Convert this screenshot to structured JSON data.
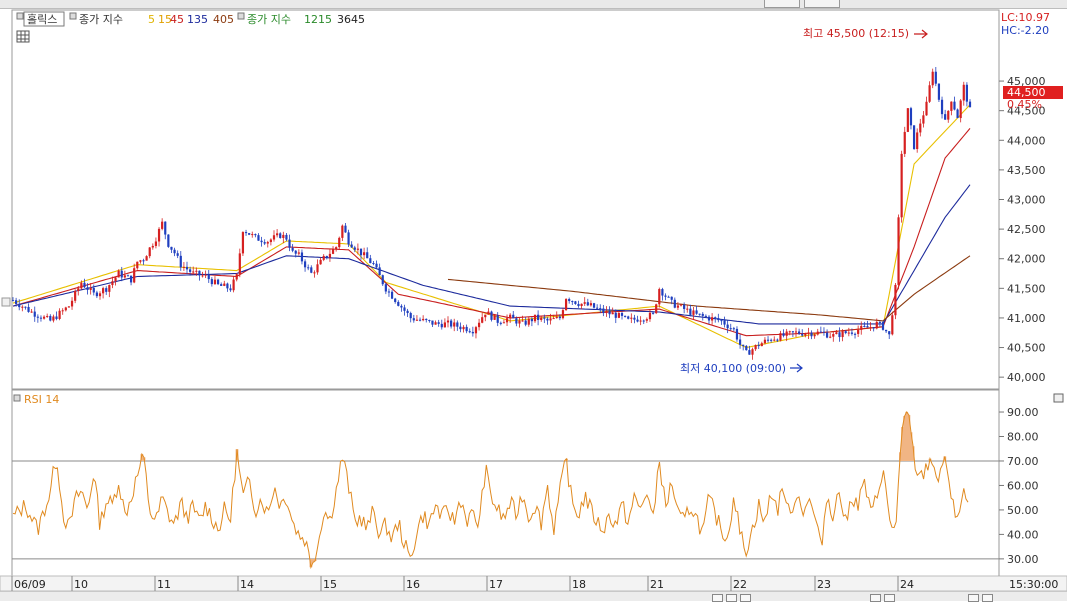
{
  "indicator_bar": {
    "tab_label": "홀릭스",
    "vol_ma_label": "종가 지수",
    "vol_ma_periods": [
      "5",
      "15",
      "45",
      "135",
      "405"
    ],
    "vol_ma_colors": [
      "#e0b400",
      "#e0a000",
      "#c81e1e",
      "#1c2a9c",
      "#8b3a0f"
    ],
    "vol_long_label": "종가 지수",
    "vol_long_periods": [
      "1215",
      "3645"
    ]
  },
  "lc_label": "LC:10.97",
  "hc_label": "HC:-2.20",
  "current_price": "44,500",
  "current_pct": "0.45%",
  "max_label": "최고 45,500 (12:15)",
  "min_label": "최저 40,100 (09:00)",
  "rsi_label": "RSI 14",
  "time_label": "15:30:00",
  "colors": {
    "up": "#d62020",
    "down": "#1f3fbf",
    "ma5": "#e8c000",
    "ma15": "#c81e1e",
    "ma45": "#1c2a9c",
    "ma135": "#8b3a0f",
    "rsi": "#e08a20",
    "grid": "#8a8a8a"
  },
  "chart_data": [
    {
      "type": "candlestick",
      "title": "",
      "y_ticks": [
        "45,000",
        "44,500",
        "44,000",
        "43,500",
        "43,000",
        "42,500",
        "42,000",
        "41,500",
        "41,000",
        "40,500",
        "40,000"
      ],
      "ylim": [
        39800,
        46200
      ],
      "x_date_labels": [
        "06/09",
        "10",
        "11",
        "14",
        "15",
        "16",
        "17",
        "18",
        "21",
        "22",
        "23",
        "24"
      ],
      "grid": false,
      "series": [
        {
          "name": "5",
          "type": "ma"
        },
        {
          "name": "15",
          "type": "ma"
        },
        {
          "name": "45",
          "type": "ma"
        },
        {
          "name": "135",
          "type": "ma"
        }
      ],
      "price_path": [
        [
          0,
          41300
        ],
        [
          3,
          41100
        ],
        [
          6,
          40950
        ],
        [
          9,
          41200
        ],
        [
          11,
          41600
        ],
        [
          13,
          41400
        ],
        [
          15,
          41500
        ],
        [
          17,
          41750
        ],
        [
          19,
          41650
        ],
        [
          20,
          41950
        ],
        [
          21,
          42000
        ],
        [
          23,
          42350
        ],
        [
          24,
          42600
        ],
        [
          25,
          42250
        ],
        [
          26,
          42100
        ],
        [
          27,
          41900
        ],
        [
          29,
          41750
        ],
        [
          31,
          41700
        ],
        [
          33,
          41550
        ],
        [
          35,
          41500
        ],
        [
          36,
          41700
        ],
        [
          37,
          42500
        ],
        [
          39,
          42350
        ],
        [
          41,
          42300
        ],
        [
          43,
          42400
        ],
        [
          44,
          42350
        ],
        [
          45,
          42100
        ],
        [
          46,
          42050
        ],
        [
          48,
          41750
        ],
        [
          50,
          42000
        ],
        [
          52,
          42200
        ],
        [
          53,
          42550
        ],
        [
          54,
          42300
        ],
        [
          56,
          42100
        ],
        [
          58,
          41900
        ],
        [
          60,
          41500
        ],
        [
          62,
          41250
        ],
        [
          64,
          41000
        ],
        [
          66,
          40950
        ],
        [
          68,
          40900
        ],
        [
          70,
          40900
        ],
        [
          72,
          40850
        ],
        [
          74,
          40800
        ],
        [
          76,
          41100
        ],
        [
          78,
          40950
        ],
        [
          80,
          41000
        ],
        [
          82,
          40900
        ],
        [
          84,
          41000
        ],
        [
          86,
          40950
        ],
        [
          88,
          41000
        ],
        [
          89,
          41350
        ],
        [
          91,
          41250
        ],
        [
          93,
          41200
        ],
        [
          95,
          41100
        ],
        [
          97,
          41050
        ],
        [
          99,
          40950
        ],
        [
          101,
          41000
        ],
        [
          103,
          41050
        ],
        [
          104,
          41500
        ],
        [
          106,
          41250
        ],
        [
          108,
          41150
        ],
        [
          110,
          41050
        ],
        [
          112,
          41000
        ],
        [
          114,
          40950
        ],
        [
          116,
          40800
        ],
        [
          117,
          40550
        ],
        [
          118,
          40400
        ],
        [
          120,
          40550
        ],
        [
          122,
          40650
        ],
        [
          124,
          40700
        ],
        [
          126,
          40750
        ],
        [
          128,
          40750
        ],
        [
          130,
          40750
        ],
        [
          132,
          40700
        ],
        [
          134,
          40750
        ],
        [
          136,
          40800
        ],
        [
          138,
          40850
        ],
        [
          139,
          40900
        ],
        [
          140,
          40850
        ],
        [
          141,
          40700
        ],
        [
          142,
          41500
        ],
        [
          143,
          43800
        ],
        [
          144,
          44500
        ],
        [
          145,
          43900
        ],
        [
          146,
          44300
        ],
        [
          147,
          44600
        ],
        [
          148,
          45200
        ],
        [
          149,
          44700
        ],
        [
          150,
          44300
        ],
        [
          151,
          44700
        ],
        [
          152,
          44400
        ],
        [
          153,
          44900
        ],
        [
          154,
          44500
        ]
      ],
      "ma_values": {
        "5": [
          [
            0,
            41250
          ],
          [
            20,
            41900
          ],
          [
            36,
            41800
          ],
          [
            44,
            42300
          ],
          [
            54,
            42250
          ],
          [
            60,
            41600
          ],
          [
            80,
            40950
          ],
          [
            104,
            41200
          ],
          [
            118,
            40500
          ],
          [
            130,
            40750
          ],
          [
            140,
            40850
          ],
          [
            145,
            43600
          ],
          [
            154,
            44600
          ]
        ],
        "15": [
          [
            0,
            41200
          ],
          [
            20,
            41800
          ],
          [
            36,
            41700
          ],
          [
            44,
            42200
          ],
          [
            54,
            42150
          ],
          [
            62,
            41400
          ],
          [
            80,
            41000
          ],
          [
            104,
            41150
          ],
          [
            118,
            40700
          ],
          [
            130,
            40750
          ],
          [
            140,
            40850
          ],
          [
            145,
            42200
          ],
          [
            150,
            43700
          ],
          [
            154,
            44200
          ]
        ],
        "45": [
          [
            0,
            41200
          ],
          [
            20,
            41700
          ],
          [
            36,
            41750
          ],
          [
            44,
            42050
          ],
          [
            54,
            42000
          ],
          [
            66,
            41550
          ],
          [
            80,
            41200
          ],
          [
            104,
            41100
          ],
          [
            120,
            40900
          ],
          [
            140,
            40900
          ],
          [
            145,
            41800
          ],
          [
            150,
            42700
          ],
          [
            154,
            43250
          ]
        ],
        "135": [
          [
            70,
            41650
          ],
          [
            90,
            41450
          ],
          [
            110,
            41200
          ],
          [
            130,
            41050
          ],
          [
            140,
            40950
          ],
          [
            145,
            41400
          ],
          [
            154,
            42050
          ]
        ]
      }
    },
    {
      "type": "line",
      "title": "RSI 14",
      "y_ticks": [
        "90.00",
        "80.00",
        "70.00",
        "60.00",
        "50.00",
        "40.00",
        "30.00"
      ],
      "ylim": [
        23,
        99
      ],
      "reference_lines": [
        70,
        30
      ],
      "series": [
        {
          "name": "RSI 14",
          "values": [
            [
              0,
              47
            ],
            [
              2,
              52
            ],
            [
              4,
              42
            ],
            [
              5,
              50
            ],
            [
              6,
              57
            ],
            [
              7,
              73
            ],
            [
              8,
              49
            ],
            [
              9,
              42
            ],
            [
              10,
              54
            ],
            [
              11,
              58
            ],
            [
              12,
              50
            ],
            [
              13,
              66
            ],
            [
              14,
              44
            ],
            [
              15,
              54
            ],
            [
              16,
              52
            ],
            [
              17,
              62
            ],
            [
              18,
              48
            ],
            [
              19,
              55
            ],
            [
              20,
              64
            ],
            [
              21,
              72
            ],
            [
              22,
              50
            ],
            [
              23,
              45
            ],
            [
              24,
              55
            ],
            [
              25,
              48
            ],
            [
              26,
              44
            ],
            [
              27,
              53
            ],
            [
              28,
              47
            ],
            [
              29,
              51
            ],
            [
              30,
              45
            ],
            [
              31,
              52
            ],
            [
              32,
              47
            ],
            [
              33,
              42
            ],
            [
              34,
              50
            ],
            [
              35,
              46
            ],
            [
              36,
              74
            ],
            [
              37,
              55
            ],
            [
              38,
              62
            ],
            [
              39,
              50
            ],
            [
              40,
              55
            ],
            [
              41,
              48
            ],
            [
              42,
              60
            ],
            [
              43,
              52
            ],
            [
              44,
              56
            ],
            [
              45,
              45
            ],
            [
              46,
              40
            ],
            [
              47,
              38
            ],
            [
              48,
              28
            ],
            [
              49,
              35
            ],
            [
              50,
              50
            ],
            [
              51,
              46
            ],
            [
              52,
              58
            ],
            [
              53,
              72
            ],
            [
              54,
              60
            ],
            [
              55,
              45
            ],
            [
              56,
              47
            ],
            [
              57,
              42
            ],
            [
              58,
              50
            ],
            [
              59,
              40
            ],
            [
              60,
              44
            ],
            [
              61,
              38
            ],
            [
              62,
              45
            ],
            [
              63,
              36
            ],
            [
              64,
              29
            ],
            [
              65,
              42
            ],
            [
              66,
              48
            ],
            [
              67,
              44
            ],
            [
              68,
              52
            ],
            [
              69,
              47
            ],
            [
              70,
              50
            ],
            [
              71,
              45
            ],
            [
              72,
              55
            ],
            [
              73,
              46
            ],
            [
              74,
              48
            ],
            [
              75,
              44
            ],
            [
              76,
              67
            ],
            [
              77,
              55
            ],
            [
              78,
              50
            ],
            [
              79,
              46
            ],
            [
              80,
              53
            ],
            [
              81,
              48
            ],
            [
              82,
              57
            ],
            [
              83,
              47
            ],
            [
              84,
              52
            ],
            [
              85,
              45
            ],
            [
              86,
              60
            ],
            [
              87,
              42
            ],
            [
              88,
              57
            ],
            [
              89,
              71
            ],
            [
              90,
              52
            ],
            [
              91,
              48
            ],
            [
              92,
              56
            ],
            [
              93,
              50
            ],
            [
              94,
              45
            ],
            [
              95,
              42
            ],
            [
              96,
              48
            ],
            [
              97,
              44
            ],
            [
              98,
              52
            ],
            [
              99,
              45
            ],
            [
              100,
              55
            ],
            [
              101,
              50
            ],
            [
              102,
              58
            ],
            [
              103,
              45
            ],
            [
              104,
              72
            ],
            [
              105,
              50
            ],
            [
              106,
              62
            ],
            [
              107,
              48
            ],
            [
              108,
              45
            ],
            [
              109,
              52
            ],
            [
              110,
              47
            ],
            [
              111,
              40
            ],
            [
              112,
              55
            ],
            [
              113,
              48
            ],
            [
              114,
              42
            ],
            [
              115,
              38
            ],
            [
              116,
              57
            ],
            [
              117,
              40
            ],
            [
              118,
              34
            ],
            [
              119,
              42
            ],
            [
              120,
              52
            ],
            [
              121,
              44
            ],
            [
              122,
              58
            ],
            [
              123,
              50
            ],
            [
              124,
              60
            ],
            [
              125,
              46
            ],
            [
              126,
              58
            ],
            [
              127,
              50
            ],
            [
              128,
              54
            ],
            [
              129,
              48
            ],
            [
              130,
              34
            ],
            [
              131,
              56
            ],
            [
              132,
              48
            ],
            [
              133,
              58
            ],
            [
              134,
              44
            ],
            [
              135,
              56
            ],
            [
              136,
              52
            ],
            [
              137,
              62
            ],
            [
              138,
              48
            ],
            [
              139,
              55
            ],
            [
              140,
              68
            ],
            [
              141,
              45
            ],
            [
              142,
              42
            ],
            [
              143,
              80
            ],
            [
              144,
              91
            ],
            [
              145,
              70
            ],
            [
              146,
              62
            ],
            [
              147,
              68
            ],
            [
              148,
              71
            ],
            [
              149,
              60
            ],
            [
              150,
              74
            ],
            [
              151,
              52
            ],
            [
              152,
              48
            ],
            [
              153,
              58
            ],
            [
              154,
              47
            ]
          ]
        }
      ]
    }
  ]
}
